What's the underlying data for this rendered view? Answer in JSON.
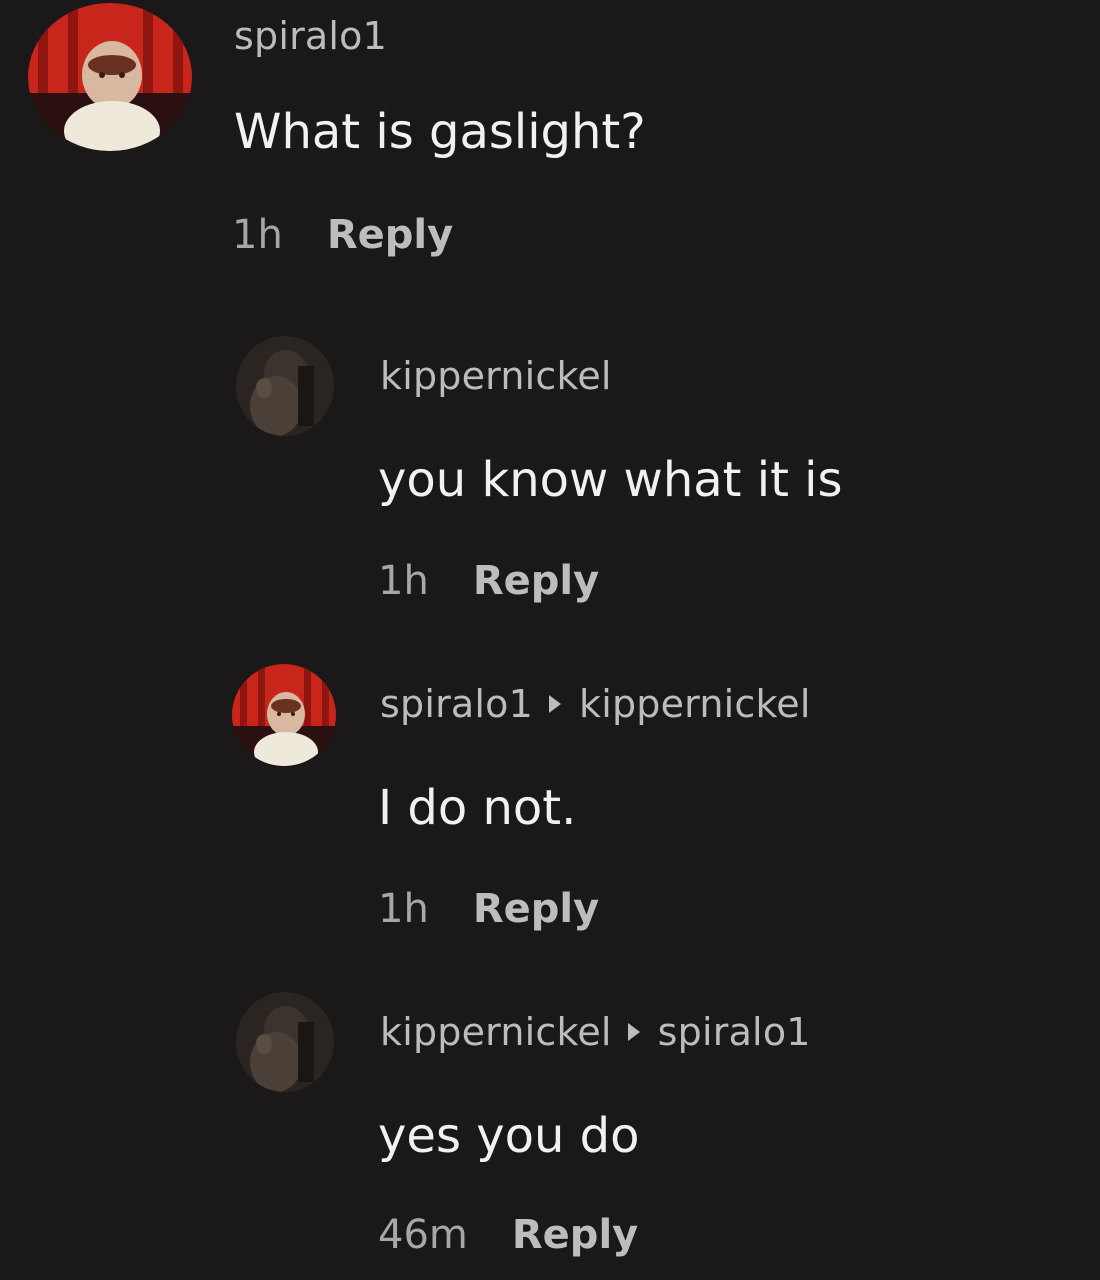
{
  "comments": [
    {
      "user": "spiralo1",
      "reply_to": "",
      "text": "What is gaslight?",
      "time": "1h",
      "reply_label": "Reply",
      "avatar": "red-curtain-figure-avatar"
    },
    {
      "user": "kippernickel",
      "reply_to": "",
      "text": "you know what it is",
      "time": "1h",
      "reply_label": "Reply",
      "avatar": "dark-figure-avatar"
    },
    {
      "user": "spiralo1",
      "reply_to": "kippernickel",
      "text": "I do not.",
      "time": "1h",
      "reply_label": "Reply",
      "avatar": "red-curtain-figure-avatar"
    },
    {
      "user": "kippernickel",
      "reply_to": "spiralo1",
      "text": "yes you do",
      "time": "46m",
      "reply_label": "Reply",
      "avatar": "dark-figure-avatar"
    }
  ],
  "colors": {
    "background": "#1a1819",
    "username": "#bdbcbd",
    "comment_text": "#f2f1f2",
    "meta": "#a8a7a8"
  }
}
